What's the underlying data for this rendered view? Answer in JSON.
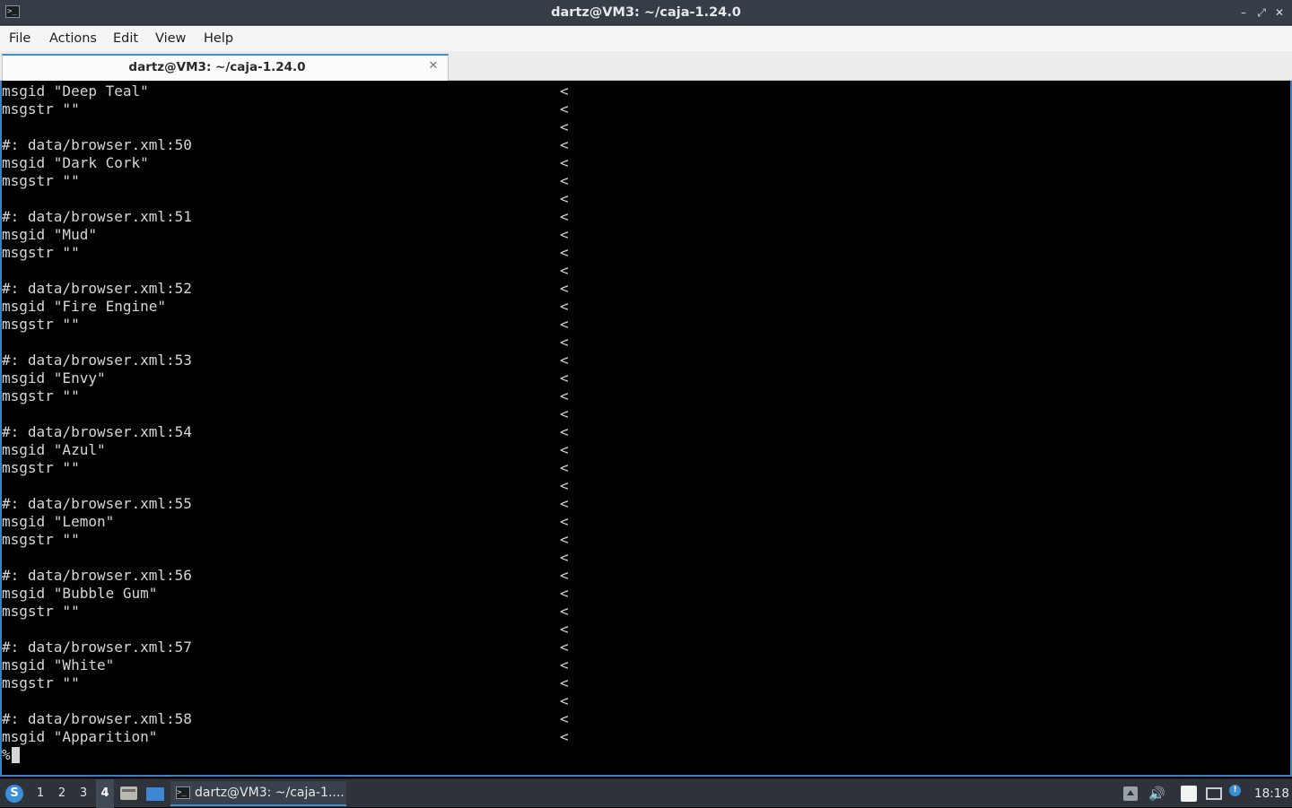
{
  "window": {
    "title": "dartz@VM3: ~/caja-1.24.0",
    "minimize_glyph": "–",
    "maximize_glyph": "⤢",
    "close_glyph": "✕"
  },
  "menubar": {
    "items": [
      "File",
      "Actions",
      "Edit",
      "View",
      "Help"
    ]
  },
  "tabs": [
    {
      "label": "dartz@VM3: ~/caja-1.24.0",
      "close_glyph": "✕"
    }
  ],
  "terminal": {
    "marker": "<",
    "lines": [
      {
        "text": "msgid \"Deep Teal\"",
        "marker": true
      },
      {
        "text": "msgstr \"\"",
        "marker": true
      },
      {
        "text": "",
        "marker": true
      },
      {
        "text": "#: data/browser.xml:50",
        "marker": true
      },
      {
        "text": "msgid \"Dark Cork\"",
        "marker": true
      },
      {
        "text": "msgstr \"\"",
        "marker": true
      },
      {
        "text": "",
        "marker": true
      },
      {
        "text": "#: data/browser.xml:51",
        "marker": true
      },
      {
        "text": "msgid \"Mud\"",
        "marker": true
      },
      {
        "text": "msgstr \"\"",
        "marker": true
      },
      {
        "text": "",
        "marker": true
      },
      {
        "text": "#: data/browser.xml:52",
        "marker": true
      },
      {
        "text": "msgid \"Fire Engine\"",
        "marker": true
      },
      {
        "text": "msgstr \"\"",
        "marker": true
      },
      {
        "text": "",
        "marker": true
      },
      {
        "text": "#: data/browser.xml:53",
        "marker": true
      },
      {
        "text": "msgid \"Envy\"",
        "marker": true
      },
      {
        "text": "msgstr \"\"",
        "marker": true
      },
      {
        "text": "",
        "marker": true
      },
      {
        "text": "#: data/browser.xml:54",
        "marker": true
      },
      {
        "text": "msgid \"Azul\"",
        "marker": true
      },
      {
        "text": "msgstr \"\"",
        "marker": true
      },
      {
        "text": "",
        "marker": true
      },
      {
        "text": "#: data/browser.xml:55",
        "marker": true
      },
      {
        "text": "msgid \"Lemon\"",
        "marker": true
      },
      {
        "text": "msgstr \"\"",
        "marker": true
      },
      {
        "text": "",
        "marker": true
      },
      {
        "text": "#: data/browser.xml:56",
        "marker": true
      },
      {
        "text": "msgid \"Bubble Gum\"",
        "marker": true
      },
      {
        "text": "msgstr \"\"",
        "marker": true
      },
      {
        "text": "",
        "marker": true
      },
      {
        "text": "#: data/browser.xml:57",
        "marker": true
      },
      {
        "text": "msgid \"White\"",
        "marker": true
      },
      {
        "text": "msgstr \"\"",
        "marker": true
      },
      {
        "text": "",
        "marker": true
      },
      {
        "text": "#: data/browser.xml:58",
        "marker": true
      },
      {
        "text": "msgid \"Apparition\"",
        "marker": true
      }
    ],
    "prompt": "%"
  },
  "taskbar": {
    "menu_glyph": "S",
    "workspaces": [
      "1",
      "2",
      "3",
      "4"
    ],
    "active_workspace": "4",
    "task_label": "dartz@VM3: ~/caja-1....",
    "clock": "18:18",
    "volume_glyph": "🔊",
    "notify_glyph": "!"
  },
  "colors": {
    "accent": "#3a8fd6",
    "terminal_bg": "#000000",
    "terminal_fg": "#d6d6d6"
  }
}
